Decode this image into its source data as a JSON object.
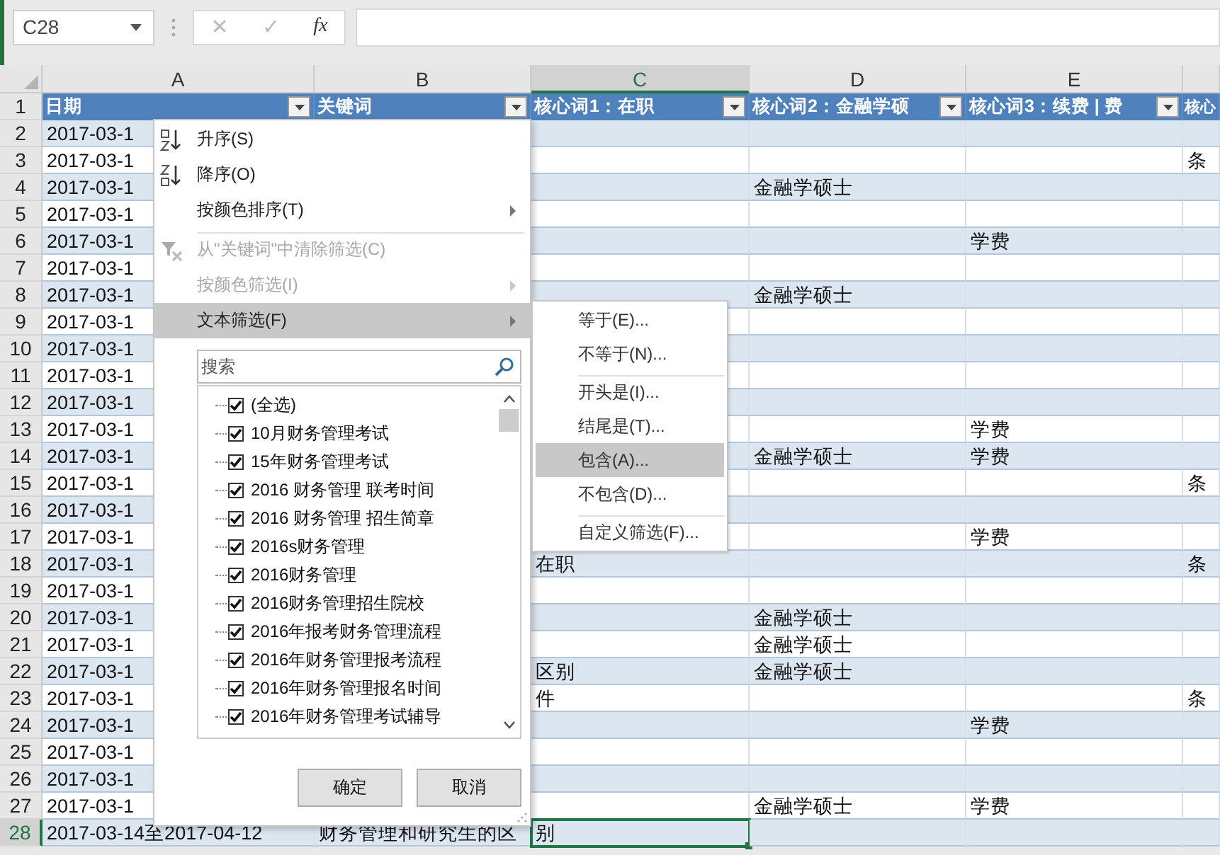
{
  "formula_bar": {
    "name_box": "C28",
    "cancel_symbol": "✕",
    "enter_symbol": "✓",
    "function_symbol": "fx"
  },
  "columns": [
    {
      "letter": "A",
      "selected": false
    },
    {
      "letter": "B",
      "selected": false
    },
    {
      "letter": "C",
      "selected": true
    },
    {
      "letter": "D",
      "selected": false
    },
    {
      "letter": "E",
      "selected": false
    }
  ],
  "header_row": {
    "number": "1",
    "cells": [
      "日期",
      "关键词",
      "核心词1：在职",
      "核心词2：金融学硕",
      "核心词3：续费 | 费",
      "核心"
    ]
  },
  "rows": [
    {
      "number": "2",
      "selected": false,
      "cells": [
        "2017-03-1",
        null,
        null,
        null,
        null,
        null
      ]
    },
    {
      "number": "3",
      "selected": false,
      "cells": [
        "2017-03-1",
        null,
        null,
        null,
        null,
        "条"
      ]
    },
    {
      "number": "4",
      "selected": false,
      "cells": [
        "2017-03-1",
        null,
        null,
        "金融学硕士",
        null,
        null
      ]
    },
    {
      "number": "5",
      "selected": false,
      "cells": [
        "2017-03-1",
        null,
        null,
        null,
        null,
        null
      ]
    },
    {
      "number": "6",
      "selected": false,
      "cells": [
        "2017-03-1",
        null,
        null,
        null,
        "学费",
        null
      ]
    },
    {
      "number": "7",
      "selected": false,
      "cells": [
        "2017-03-1",
        null,
        null,
        null,
        null,
        null
      ]
    },
    {
      "number": "8",
      "selected": false,
      "cells": [
        "2017-03-1",
        null,
        null,
        "金融学硕士",
        null,
        null
      ]
    },
    {
      "number": "9",
      "selected": false,
      "cells": [
        "2017-03-1",
        null,
        null,
        null,
        null,
        null
      ]
    },
    {
      "number": "10",
      "selected": false,
      "cells": [
        "2017-03-1",
        null,
        null,
        null,
        null,
        null
      ]
    },
    {
      "number": "11",
      "selected": false,
      "cells": [
        "2017-03-1",
        null,
        null,
        null,
        null,
        null
      ]
    },
    {
      "number": "12",
      "selected": false,
      "cells": [
        "2017-03-1",
        null,
        null,
        null,
        null,
        null
      ]
    },
    {
      "number": "13",
      "selected": false,
      "cells": [
        "2017-03-1",
        null,
        null,
        null,
        "学费",
        null
      ]
    },
    {
      "number": "14",
      "selected": false,
      "cells": [
        "2017-03-1",
        null,
        null,
        "金融学硕士",
        "学费",
        null
      ]
    },
    {
      "number": "15",
      "selected": false,
      "cells": [
        "2017-03-1",
        null,
        null,
        null,
        null,
        "条"
      ]
    },
    {
      "number": "16",
      "selected": false,
      "cells": [
        "2017-03-1",
        null,
        null,
        null,
        null,
        null
      ]
    },
    {
      "number": "17",
      "selected": false,
      "cells": [
        "2017-03-1",
        null,
        null,
        null,
        "学费",
        null
      ]
    },
    {
      "number": "18",
      "selected": false,
      "cells": [
        "2017-03-1",
        null,
        "在职",
        null,
        null,
        "条"
      ]
    },
    {
      "number": "19",
      "selected": false,
      "cells": [
        "2017-03-1",
        null,
        null,
        null,
        null,
        null
      ]
    },
    {
      "number": "20",
      "selected": false,
      "cells": [
        "2017-03-1",
        null,
        null,
        "金融学硕士",
        null,
        null
      ]
    },
    {
      "number": "21",
      "selected": false,
      "cells": [
        "2017-03-1",
        null,
        null,
        "金融学硕士",
        null,
        null
      ]
    },
    {
      "number": "22",
      "selected": false,
      "cells": [
        "2017-03-1",
        null,
        "区别",
        "金融学硕士",
        null,
        null
      ]
    },
    {
      "number": "23",
      "selected": false,
      "cells": [
        "2017-03-1",
        null,
        "件",
        null,
        null,
        "条"
      ]
    },
    {
      "number": "24",
      "selected": false,
      "cells": [
        "2017-03-1",
        null,
        null,
        null,
        "学费",
        null
      ]
    },
    {
      "number": "25",
      "selected": false,
      "cells": [
        "2017-03-1",
        null,
        null,
        null,
        null,
        null
      ]
    },
    {
      "number": "26",
      "selected": false,
      "cells": [
        "2017-03-1",
        null,
        null,
        null,
        null,
        null
      ]
    },
    {
      "number": "27",
      "selected": false,
      "cells": [
        "2017-03-1",
        null,
        null,
        "金融学硕士",
        "学费",
        null
      ]
    },
    {
      "number": "28",
      "selected": true,
      "cells": [
        "2017-03-14至2017-04-12",
        "财务管理和研究生的区",
        "别",
        null,
        null,
        null
      ]
    }
  ],
  "filter_menu": {
    "items": [
      {
        "kind": "sort-ascending",
        "label": "升序(S)",
        "disabled": false,
        "selected": false,
        "submenu": false,
        "separator_before": false
      },
      {
        "kind": "sort-descending",
        "label": "降序(O)",
        "disabled": false,
        "selected": false,
        "submenu": false,
        "separator_before": false
      },
      {
        "kind": "plain",
        "label": "按颜色排序(T)",
        "disabled": false,
        "selected": false,
        "submenu": true,
        "separator_before": false
      },
      {
        "kind": "clear-filter",
        "label": "从\"关键词\"中清除筛选(C)",
        "disabled": true,
        "selected": false,
        "submenu": false,
        "separator_before": true
      },
      {
        "kind": "plain",
        "label": "按颜色筛选(I)",
        "disabled": true,
        "selected": false,
        "submenu": true,
        "separator_before": false
      },
      {
        "kind": "plain",
        "label": "文本筛选(F)",
        "disabled": false,
        "selected": true,
        "submenu": true,
        "separator_before": false
      }
    ],
    "search": {
      "placeholder": "搜索"
    },
    "values": [
      {
        "label": "(全选)",
        "checked": true
      },
      {
        "label": "10月财务管理考试",
        "checked": true
      },
      {
        "label": "15年财务管理考试",
        "checked": true
      },
      {
        "label": "2016 财务管理 联考时间",
        "checked": true
      },
      {
        "label": "2016 财务管理 招生简章",
        "checked": true
      },
      {
        "label": "2016s财务管理",
        "checked": true
      },
      {
        "label": "2016财务管理",
        "checked": true
      },
      {
        "label": "2016财务管理招生院校",
        "checked": true
      },
      {
        "label": "2016年报考财务管理流程",
        "checked": true
      },
      {
        "label": "2016年财务管理报考流程",
        "checked": true
      },
      {
        "label": "2016年财务管理报名时间",
        "checked": true
      },
      {
        "label": "2016年财务管理考试辅导",
        "checked": true
      }
    ],
    "buttons": [
      "确定",
      "取消"
    ]
  },
  "text_filter_submenu": {
    "items": [
      {
        "label": "等于(E)...",
        "selected": false,
        "separator_before": false
      },
      {
        "label": "不等于(N)...",
        "selected": false,
        "separator_before": false
      },
      {
        "label": "开头是(I)...",
        "selected": false,
        "separator_before": true
      },
      {
        "label": "结尾是(T)...",
        "selected": false,
        "separator_before": false
      },
      {
        "label": "包含(A)...",
        "selected": true,
        "separator_before": false
      },
      {
        "label": "不包含(D)...",
        "selected": false,
        "separator_before": false
      },
      {
        "label": "自定义筛选(F)...",
        "selected": false,
        "separator_before": true
      }
    ]
  }
}
